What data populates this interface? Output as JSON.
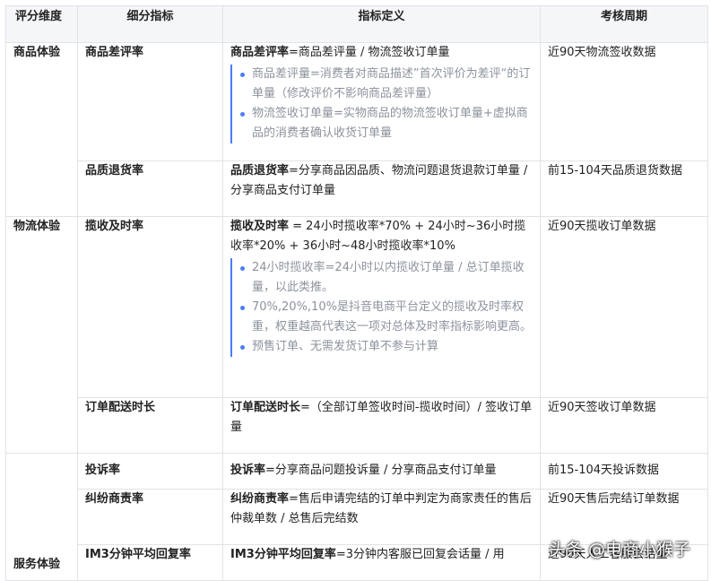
{
  "headers": [
    "评分维度",
    "细分指标",
    "指标定义",
    "考核周期"
  ],
  "dims": [
    "商品体验",
    "物流体验",
    "服务体验"
  ],
  "rows": [
    {
      "metric": "商品差评率",
      "def_term": "商品差评率",
      "def_rest": "=商品差评量 / 物流签收订单量",
      "notes": [
        "商品差评量=消费者对商品描述”首次评价为差评“的订单量（修改评价不影响商品差评量）",
        "物流签收订单量=实物商品的物流签收订单量+虚拟商品的消费者确认收货订单量"
      ],
      "period": "近90天物流签收数据"
    },
    {
      "metric": "品质退货率",
      "def_term": "品质退货率",
      "def_rest": "=分享商品因品质、物流问题退货退款订单量 / 分享商品支付订单量",
      "period": "前15-104天品质退货数据"
    },
    {
      "metric": "揽收及时率",
      "def_term": "揽收及时率",
      "def_rest": " = 24小时揽收率*70% + 24小时~36小时揽收率*20% + 36小时~48小时揽收率*10%",
      "notes": [
        "24小时揽收率=24小时以内揽收订单量 / 总订单揽收量，以此类推。",
        "70%,20%,10%是抖音电商平台定义的揽收及时率权重，权重越高代表这一项对总体及时率指标影响更高。",
        "预售订单、无需发货订单不参与计算"
      ],
      "period": "近90天揽收订单数据"
    },
    {
      "metric": "订单配送时长",
      "def_term": "订单配送时长",
      "def_rest": "=（全部订单签收时间-揽收时间）/ 签收订单量",
      "period": "近90天签收订单数据"
    },
    {
      "metric": "投诉率",
      "def_term": "投诉率",
      "def_rest": "=分享商品问题投诉量 / 分享商品支付订单量",
      "period": "前15-104天投诉数据"
    },
    {
      "metric": "纠纷商责率",
      "def_term": "纠纷商责率",
      "def_rest": "=售后申请完结的订单中判定为商家责任的售后仲裁单数 / 总售后完结数",
      "period": "近90天售后完结订单数据"
    },
    {
      "metric": "IM3分钟平均回复率",
      "def_term": "IM3分钟平均回复率",
      "def_rest": "=3分钟内客服已回复会话量 / 用",
      "period": "近90天人工客服会话量"
    }
  ],
  "watermark": "头条 @电商小猴子"
}
